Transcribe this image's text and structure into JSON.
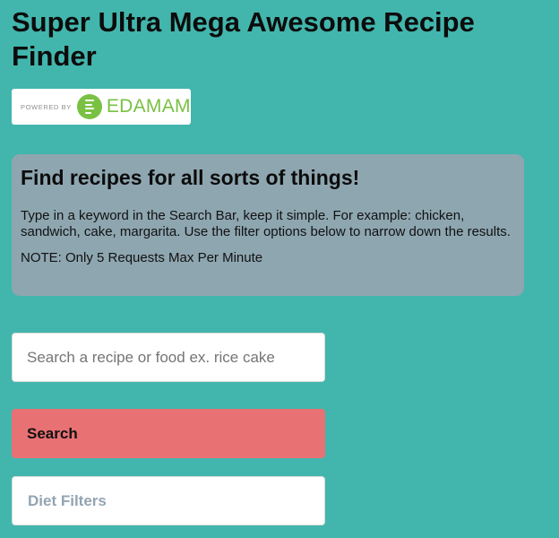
{
  "header": {
    "title": "Super Ultra Mega Awesome Recipe Finder"
  },
  "badge": {
    "powered_by": "POWERED BY",
    "brand": "EDAMAM",
    "logo_icon": "edamam-logo-icon",
    "brand_color": "#7ac143"
  },
  "info": {
    "heading": "Find recipes for all sorts of things!",
    "instructions": "Type in a keyword in the Search Bar, keep it simple. For example: chicken, sandwich, cake, margarita. Use the filter options below to narrow down the results.",
    "note": "NOTE: Only 5 Requests Max Per Minute"
  },
  "search": {
    "value": "",
    "placeholder": "Search a recipe or food ex. rice cake",
    "button_label": "Search"
  },
  "filters": {
    "diet_label": "Diet Filters"
  },
  "colors": {
    "background": "#42b6ad",
    "info_panel": "#8ea6b0",
    "search_button": "#e87174",
    "filter_text": "#93a4b2"
  }
}
